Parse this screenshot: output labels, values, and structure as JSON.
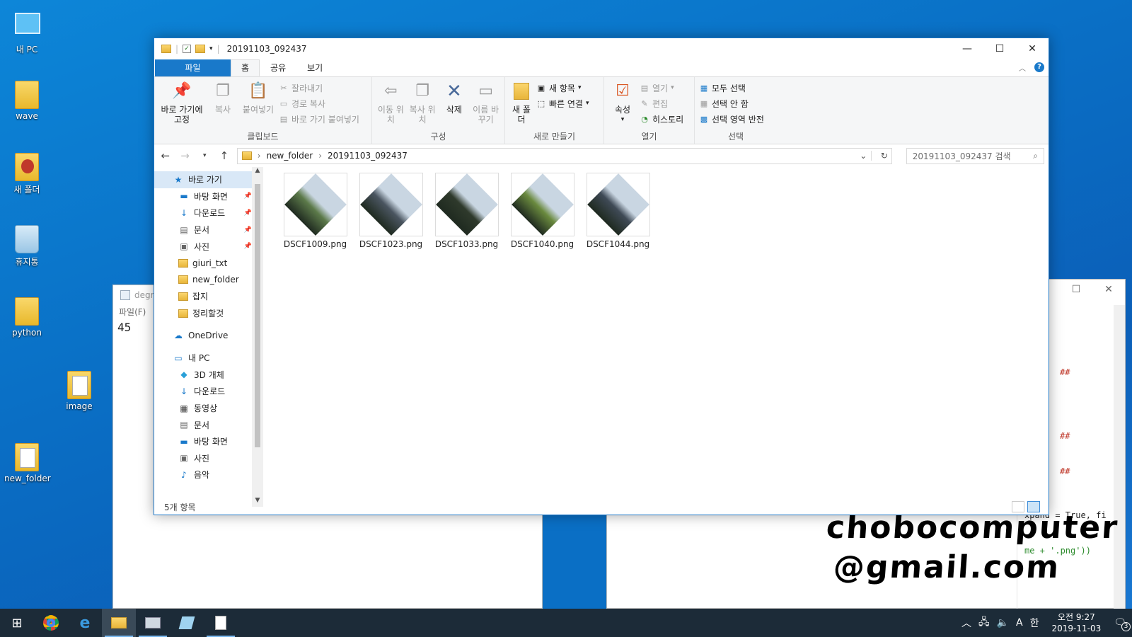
{
  "desktop": {
    "icons": [
      {
        "label": "내 PC"
      },
      {
        "label": "wave"
      },
      {
        "label": "새 폴더"
      },
      {
        "label": "휴지통"
      },
      {
        "label": "python"
      },
      {
        "label": "image"
      },
      {
        "label": "new_folder"
      }
    ]
  },
  "notepad": {
    "title": "degre",
    "menu": "파일(F)",
    "content": "45"
  },
  "code_window": {
    "snippets": [
      "xpand = True, fi",
      "me + '.png'))",
      "##",
      "##",
      "##"
    ],
    "keyword": "True"
  },
  "watermark": {
    "line1": "chobocomputer",
    "line2": "@gmail.com"
  },
  "explorer": {
    "title": "20191103_092437",
    "tabs": [
      {
        "label": "파일"
      },
      {
        "label": "홈"
      },
      {
        "label": "공유"
      },
      {
        "label": "보기"
      }
    ],
    "ribbon": {
      "clipboard": {
        "name": "클립보드",
        "pin": "바로 가기에 고정",
        "copy": "복사",
        "paste": "붙여넣기",
        "cut": "잘라내기",
        "copy_path": "경로 복사",
        "paste_shortcut": "바로 가기 붙여넣기"
      },
      "organize": {
        "name": "구성",
        "move": "이동 위치",
        "copyto": "복사 위치",
        "delete": "삭제",
        "rename": "이름 바꾸기"
      },
      "new": {
        "name": "새로 만들기",
        "new_folder": "새 폴더",
        "new_item": "새 항목",
        "easy_access": "빠른 연결"
      },
      "open": {
        "name": "열기",
        "properties": "속성",
        "open": "열기",
        "edit": "편집",
        "history": "히스토리"
      },
      "select": {
        "name": "선택",
        "select_all": "모두 선택",
        "select_none": "선택 안 함",
        "invert": "선택 영역 반전"
      }
    },
    "address": {
      "parts": [
        "new_folder",
        "20191103_092437"
      ]
    },
    "search": {
      "placeholder": "20191103_092437 검색"
    },
    "nav": {
      "quick_access": "바로 가기",
      "quick_items": [
        {
          "label": "바탕 화면"
        },
        {
          "label": "다운로드"
        },
        {
          "label": "문서"
        },
        {
          "label": "사진"
        },
        {
          "label": "giuri_txt"
        },
        {
          "label": "new_folder"
        },
        {
          "label": "잡지"
        },
        {
          "label": "정리할것"
        }
      ],
      "onedrive": "OneDrive",
      "this_pc": "내 PC",
      "pc_items": [
        {
          "label": "3D 개체"
        },
        {
          "label": "다운로드"
        },
        {
          "label": "동영상"
        },
        {
          "label": "문서"
        },
        {
          "label": "바탕 화면"
        },
        {
          "label": "사진"
        },
        {
          "label": "음악"
        }
      ]
    },
    "files": [
      {
        "name": "DSCF1009.png",
        "color": "#5c7a4a"
      },
      {
        "name": "DSCF1023.png",
        "color": "#4a5560"
      },
      {
        "name": "DSCF1033.png",
        "color": "#2f3a2c"
      },
      {
        "name": "DSCF1040.png",
        "color": "#6a8a3e"
      },
      {
        "name": "DSCF1044.png",
        "color": "#3f4a56"
      }
    ],
    "status": "5개 항목"
  },
  "taskbar": {
    "time": "오전 9:27",
    "date": "2019-11-03",
    "ime": "A",
    "lang": "한",
    "notifications": "3"
  },
  "colors": {
    "accent": "#1979ca",
    "desktop": "#0a6fc5",
    "taskbar": "#1c2b38"
  }
}
